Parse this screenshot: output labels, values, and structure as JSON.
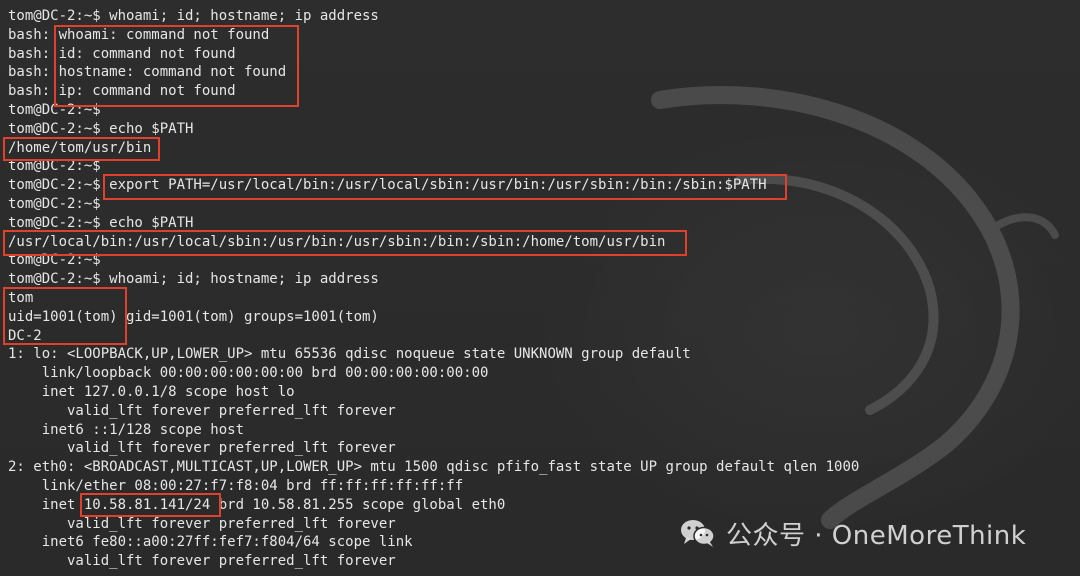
{
  "terminal": {
    "lines": [
      "tom@DC-2:~$ whoami; id; hostname; ip address",
      "bash: whoami: command not found",
      "bash: id: command not found",
      "bash: hostname: command not found",
      "bash: ip: command not found",
      "tom@DC-2:~$",
      "tom@DC-2:~$ echo $PATH",
      "/home/tom/usr/bin",
      "tom@DC-2:~$",
      "tom@DC-2:~$ export PATH=/usr/local/bin:/usr/local/sbin:/usr/bin:/usr/sbin:/bin:/sbin:$PATH",
      "tom@DC-2:~$",
      "tom@DC-2:~$ echo $PATH",
      "/usr/local/bin:/usr/local/sbin:/usr/bin:/usr/sbin:/bin:/sbin:/home/tom/usr/bin",
      "tom@DC-2:~$",
      "tom@DC-2:~$ whoami; id; hostname; ip address",
      "tom",
      "uid=1001(tom) gid=1001(tom) groups=1001(tom)",
      "DC-2",
      "1: lo: <LOOPBACK,UP,LOWER_UP> mtu 65536 qdisc noqueue state UNKNOWN group default",
      "    link/loopback 00:00:00:00:00:00 brd 00:00:00:00:00:00",
      "    inet 127.0.0.1/8 scope host lo",
      "       valid_lft forever preferred_lft forever",
      "    inet6 ::1/128 scope host",
      "       valid_lft forever preferred_lft forever",
      "2: eth0: <BROADCAST,MULTICAST,UP,LOWER_UP> mtu 1500 qdisc pfifo_fast state UP group default qlen 1000",
      "    link/ether 08:00:27:f7:f8:04 brd ff:ff:ff:ff:ff:ff",
      "    inet 10.58.81.141/24 brd 10.58.81.255 scope global eth0",
      "       valid_lft forever preferred_lft forever",
      "    inet6 fe80::a00:27ff:fef7:f804/64 scope link",
      "       valid_lft forever preferred_lft forever"
    ]
  },
  "watermark": {
    "text": "公众号 · OneMoreThink",
    "icon": "wechat-icon"
  },
  "colors": {
    "background": "#2b2b2b",
    "text": "#e6e6e6",
    "highlight": "#e0412c"
  }
}
